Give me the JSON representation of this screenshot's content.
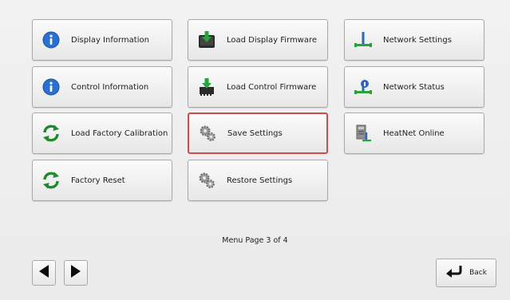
{
  "menu": {
    "col1": [
      {
        "label": "Display Information",
        "icon": "info-icon"
      },
      {
        "label": "Control Information",
        "icon": "info-icon"
      },
      {
        "label": "Load Factory Calibration",
        "icon": "refresh-icon"
      },
      {
        "label": "Factory Reset",
        "icon": "refresh-icon"
      }
    ],
    "col2": [
      {
        "label": "Load Display Firmware",
        "icon": "display-firmware-icon"
      },
      {
        "label": "Load Control Firmware",
        "icon": "control-firmware-icon"
      },
      {
        "label": "Save Settings",
        "icon": "gears-icon"
      },
      {
        "label": "Restore Settings",
        "icon": "gears-icon"
      }
    ],
    "col3": [
      {
        "label": "Network Settings",
        "icon": "network-icon"
      },
      {
        "label": "Network Status",
        "icon": "network-status-icon"
      },
      {
        "label": "HeatNet Online",
        "icon": "heatnet-icon"
      }
    ]
  },
  "selected_item": "Save Settings",
  "page_indicator": "Menu Page 3 of 4",
  "nav": {
    "prev_icon": "triangle-left-icon",
    "next_icon": "triangle-right-icon",
    "back_label": "Back",
    "back_icon": "return-arrow-icon"
  },
  "colors": {
    "selection_border": "#d44a4a",
    "info_blue": "#2a6fd1",
    "refresh_green": "#1f8a2e",
    "firmware_green": "#2aa33a"
  }
}
